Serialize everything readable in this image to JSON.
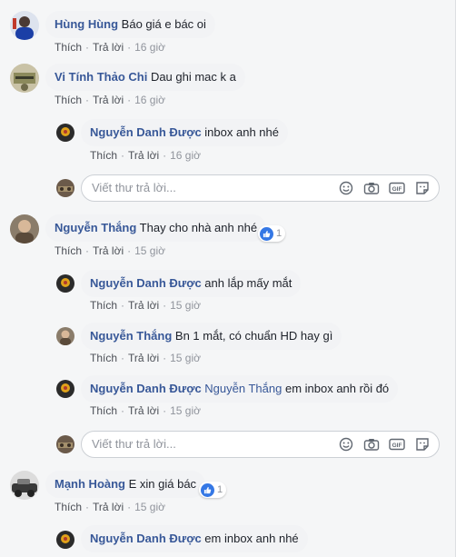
{
  "ui": {
    "like_label": "Thích",
    "reply_label": "Trả lời",
    "reply_placeholder": "Viết thư trả lời..."
  },
  "comments": [
    {
      "name": "Hùng Hùng",
      "mention": "",
      "text": "Báo giá e bác oi",
      "time": "16 giờ",
      "reactions": ""
    },
    {
      "name": "Vi Tính Thảo Chi",
      "mention": "",
      "text": "Dau ghi mac k a",
      "time": "16 giờ",
      "reactions": ""
    },
    {
      "name": "Nguyễn Danh Được",
      "mention": "",
      "text": "inbox anh nhé",
      "time": "16 giờ",
      "reactions": ""
    },
    {
      "name": "Nguyễn Thắng",
      "mention": "",
      "text": "Thay cho nhà anh nhé",
      "time": "15 giờ",
      "reactions": "1"
    },
    {
      "name": "Nguyễn Danh Được",
      "mention": "",
      "text": "anh lắp mấy mắt",
      "time": "15 giờ",
      "reactions": ""
    },
    {
      "name": "Nguyễn Thắng",
      "mention": "",
      "text": "Bn 1 mắt, có chuẩn HD hay gì",
      "time": "15 giờ",
      "reactions": ""
    },
    {
      "name": "Nguyễn Danh Được",
      "mention": "Nguyễn Thắng",
      "text": "em inbox anh rồi đó",
      "time": "15 giờ",
      "reactions": ""
    },
    {
      "name": "Mạnh Hoàng",
      "mention": "",
      "text": "E xin giá bác",
      "time": "15 giờ",
      "reactions": "1"
    },
    {
      "name": "Nguyễn Danh Được",
      "mention": "",
      "text": "em inbox anh nhé",
      "time": "",
      "reactions": ""
    }
  ],
  "icons": {
    "emoji": "smiley-icon",
    "camera": "camera-icon",
    "gif": "GIF",
    "sticker": "sticker-icon",
    "like": "thumbs-up-icon"
  },
  "colors": {
    "name": "#385898",
    "bubble": "#f2f3f5",
    "like_blue": "#3578e5",
    "meta": "#90949c"
  }
}
